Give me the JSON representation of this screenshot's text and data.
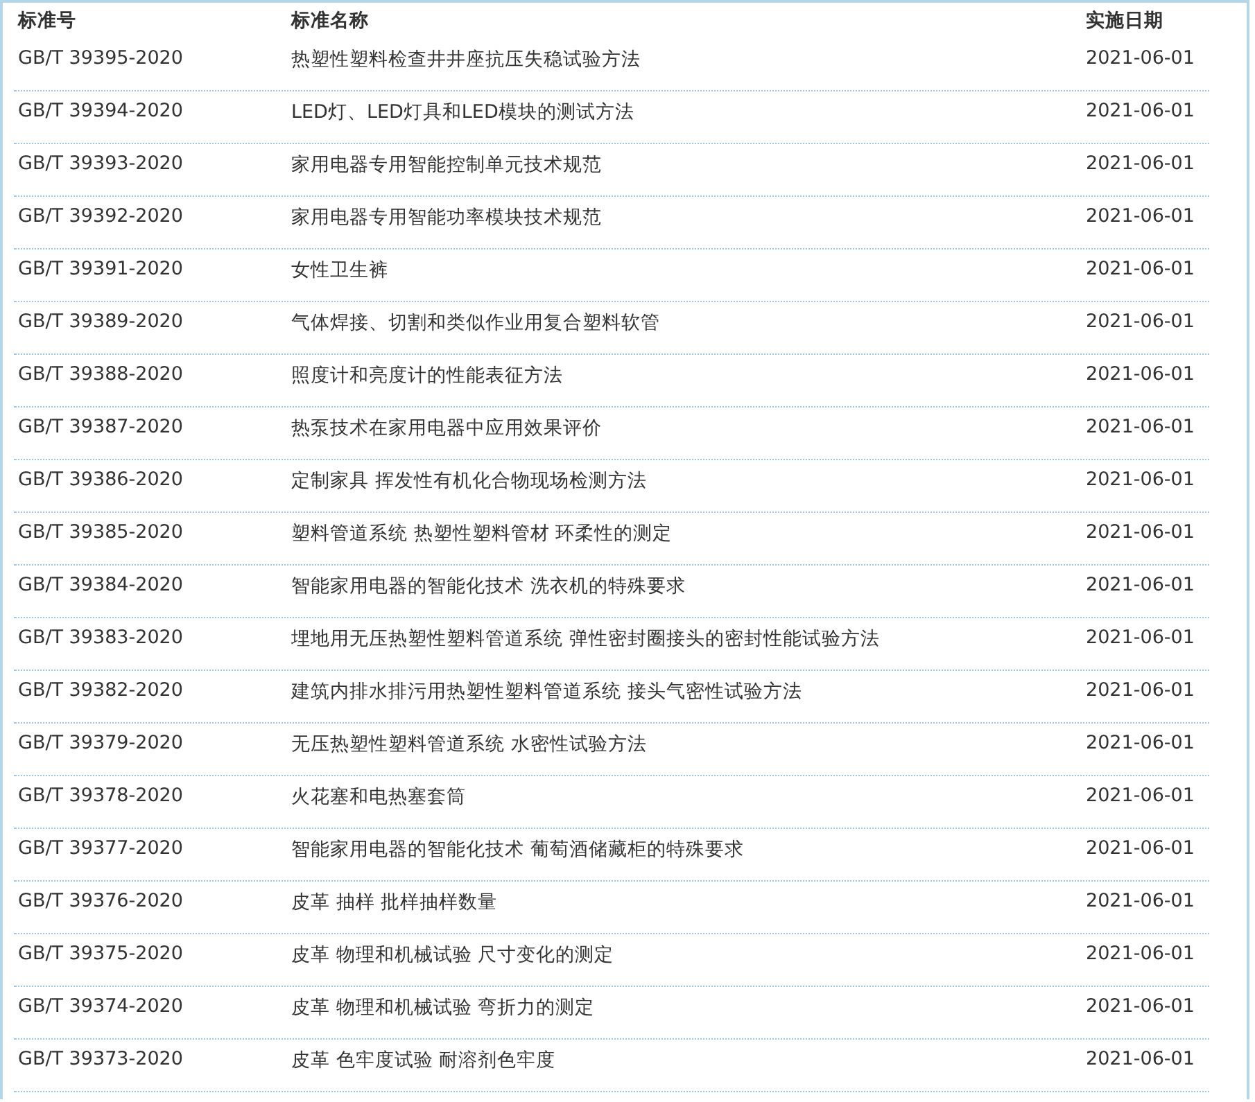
{
  "table": {
    "columns": [
      "标准号",
      "标准名称",
      "实施日期"
    ],
    "rows": [
      {
        "code": "GB/T 39395-2020",
        "name": "热塑性塑料检查井井座抗压失稳试验方法",
        "date": "2021-06-01"
      },
      {
        "code": "GB/T 39394-2020",
        "name": "LED灯、LED灯具和LED模块的测试方法",
        "date": "2021-06-01"
      },
      {
        "code": "GB/T 39393-2020",
        "name": "家用电器专用智能控制单元技术规范",
        "date": "2021-06-01"
      },
      {
        "code": "GB/T 39392-2020",
        "name": "家用电器专用智能功率模块技术规范",
        "date": "2021-06-01"
      },
      {
        "code": "GB/T 39391-2020",
        "name": "女性卫生裤",
        "date": "2021-06-01"
      },
      {
        "code": "GB/T 39389-2020",
        "name": "气体焊接、切割和类似作业用复合塑料软管",
        "date": "2021-06-01"
      },
      {
        "code": "GB/T 39388-2020",
        "name": "照度计和亮度计的性能表征方法",
        "date": "2021-06-01"
      },
      {
        "code": "GB/T 39387-2020",
        "name": "热泵技术在家用电器中应用效果评价",
        "date": "2021-06-01"
      },
      {
        "code": "GB/T 39386-2020",
        "name": "定制家具 挥发性有机化合物现场检测方法",
        "date": "2021-06-01"
      },
      {
        "code": "GB/T 39385-2020",
        "name": "塑料管道系统 热塑性塑料管材 环柔性的测定",
        "date": "2021-06-01"
      },
      {
        "code": "GB/T 39384-2020",
        "name": "智能家用电器的智能化技术 洗衣机的特殊要求",
        "date": "2021-06-01"
      },
      {
        "code": "GB/T 39383-2020",
        "name": "埋地用无压热塑性塑料管道系统 弹性密封圈接头的密封性能试验方法",
        "date": "2021-06-01"
      },
      {
        "code": "GB/T 39382-2020",
        "name": "建筑内排水排污用热塑性塑料管道系统 接头气密性试验方法",
        "date": "2021-06-01"
      },
      {
        "code": "GB/T 39379-2020",
        "name": "无压热塑性塑料管道系统 水密性试验方法",
        "date": "2021-06-01"
      },
      {
        "code": "GB/T 39378-2020",
        "name": "火花塞和电热塞套筒",
        "date": "2021-06-01"
      },
      {
        "code": "GB/T 39377-2020",
        "name": "智能家用电器的智能化技术 葡萄酒储藏柜的特殊要求",
        "date": "2021-06-01"
      },
      {
        "code": "GB/T 39376-2020",
        "name": "皮革 抽样 批样抽样数量",
        "date": "2021-06-01"
      },
      {
        "code": "GB/T 39375-2020",
        "name": "皮革 物理和机械试验 尺寸变化的测定",
        "date": "2021-06-01"
      },
      {
        "code": "GB/T 39374-2020",
        "name": "皮革 物理和机械试验 弯折力的测定",
        "date": "2021-06-01"
      },
      {
        "code": "GB/T 39373-2020",
        "name": "皮革 色牢度试验 耐溶剂色牢度",
        "date": "2021-06-01"
      }
    ]
  }
}
